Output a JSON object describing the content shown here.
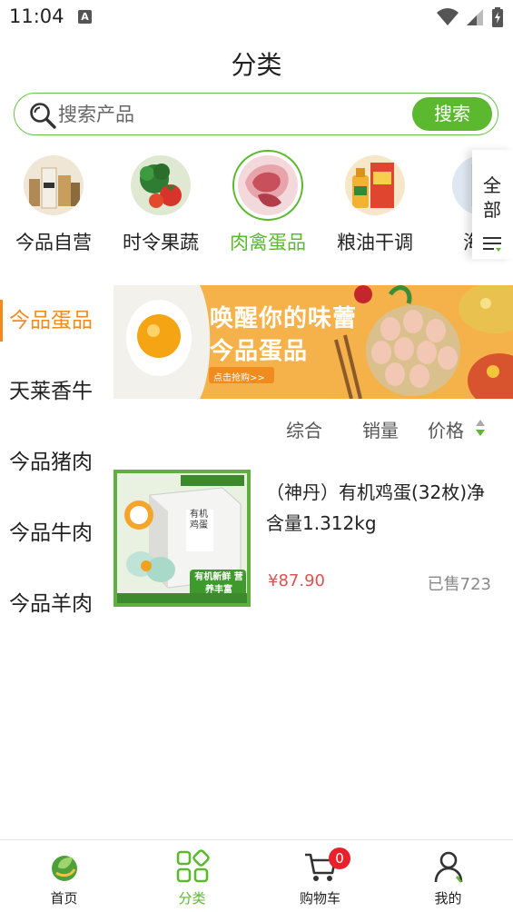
{
  "status_bar": {
    "time": "11:04",
    "notification_letter": "A"
  },
  "header": {
    "title": "分类"
  },
  "search": {
    "placeholder": "搜索产品",
    "button_label": "搜索"
  },
  "top_categories": [
    {
      "label": "今品自营",
      "icon": "food-package-photo",
      "active": false
    },
    {
      "label": "时令果蔬",
      "icon": "vegetables-photo",
      "active": false
    },
    {
      "label": "肉禽蛋品",
      "icon": "meat-photo",
      "active": true
    },
    {
      "label": "粮油干调",
      "icon": "grain-oil-photo",
      "active": false
    },
    {
      "label": "海鲜",
      "icon": "seafood-photo",
      "active": false
    }
  ],
  "all_button": {
    "label": "全部"
  },
  "side_menu": [
    {
      "label": "今品蛋品",
      "active": true
    },
    {
      "label": "天莱香牛",
      "active": false
    },
    {
      "label": "今品猪肉",
      "active": false
    },
    {
      "label": "今品牛肉",
      "active": false
    },
    {
      "label": "今品羊肉",
      "active": false
    }
  ],
  "banner": {
    "headline": "唤醒你的味蕾",
    "subline": "今品蛋品",
    "cta": "点击抢购>>"
  },
  "sort": {
    "overall": "综合",
    "sales": "销量",
    "price": "价格"
  },
  "products": [
    {
      "name": "（神丹）有机鸡蛋(32枚)净含量1.312kg",
      "price": "¥87.90",
      "sold": "已售723",
      "thumb_text_top": "有机鸡蛋",
      "thumb_text_badge": "有机新鲜 营养丰富"
    }
  ],
  "bottom_nav": [
    {
      "label": "首页",
      "icon": "home-leaf-icon",
      "active": false
    },
    {
      "label": "分类",
      "icon": "category-grid-icon",
      "active": true
    },
    {
      "label": "购物车",
      "icon": "shopping-cart-icon",
      "active": false,
      "badge": "0"
    },
    {
      "label": "我的",
      "icon": "user-profile-icon",
      "active": false
    }
  ],
  "colors": {
    "brand_green": "#5cb82e",
    "active_orange": "#f08c1e",
    "price_red": "#d9534f",
    "badge_red": "#e8212b"
  }
}
